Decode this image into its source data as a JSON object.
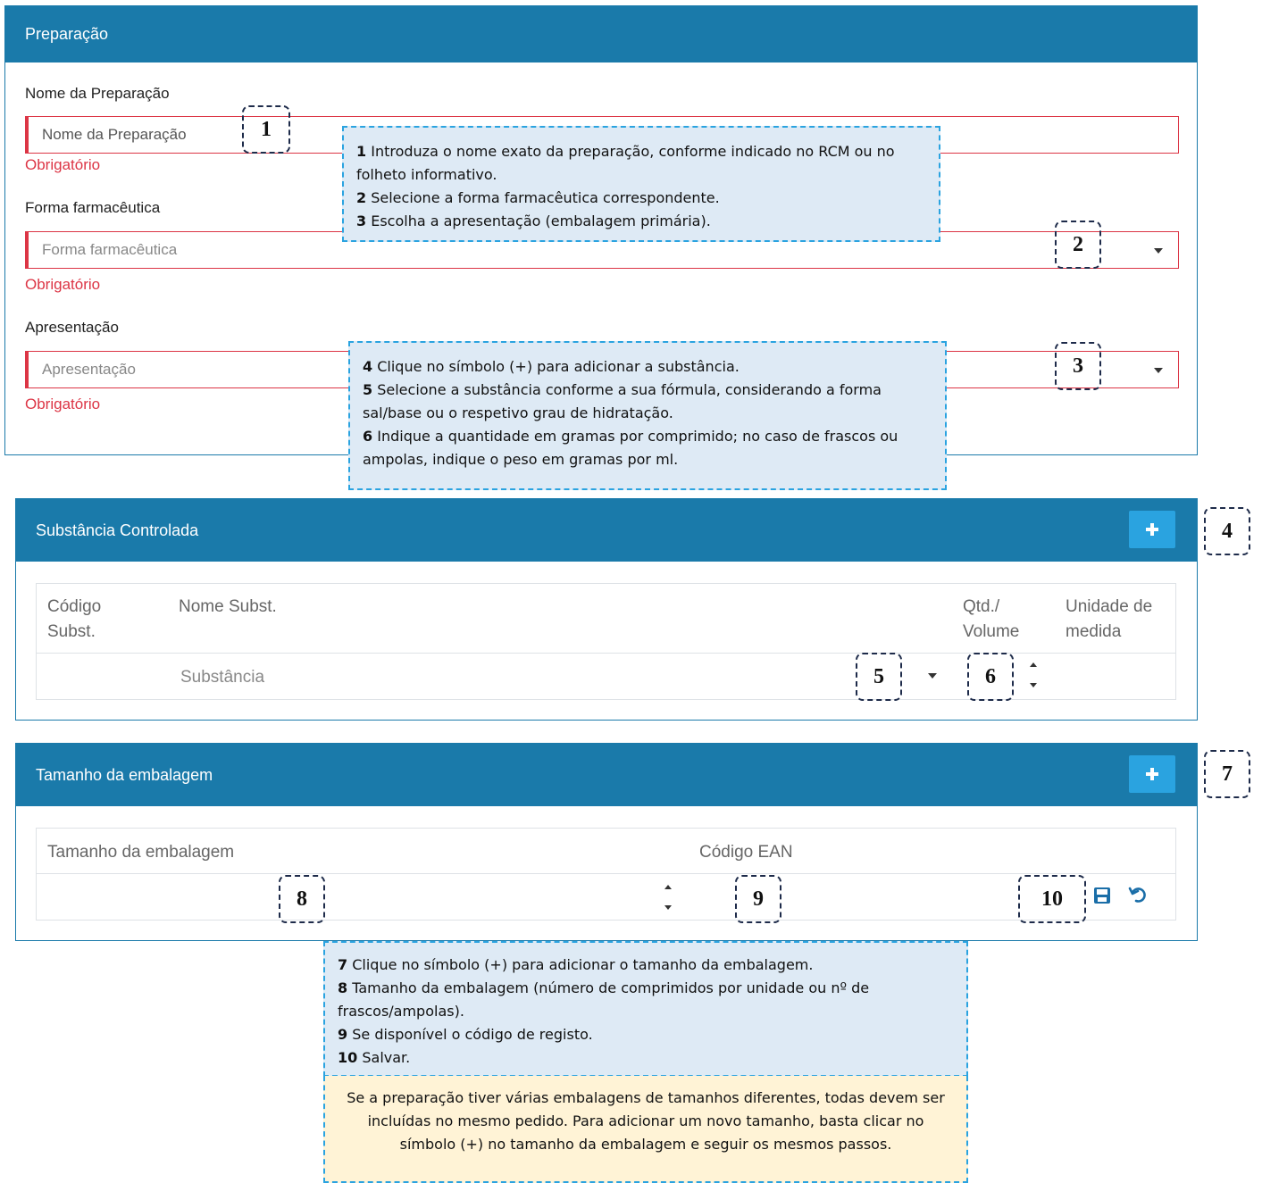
{
  "preparacao": {
    "title": "Preparação",
    "nome_label": "Nome da Preparação",
    "nome_placeholder": "Nome da Preparação",
    "forma_label": "Forma farmacêutica",
    "forma_placeholder": "Forma farmacêutica",
    "apresentacao_label": "Apresentação",
    "apresentacao_placeholder": "Apresentação",
    "required_text": "Obrigatório"
  },
  "substancia": {
    "title": "Substância Controlada",
    "col_codigo": "Código Subst.",
    "col_nome": "Nome Subst.",
    "col_qtd": "Qtd./ Volume",
    "col_unidade": "Unidade de medida",
    "substancia_placeholder": "Substância"
  },
  "embalagem": {
    "title": "Tamanho da embalagem",
    "col_tamanho": "Tamanho da embalagem",
    "col_ean": "Código EAN"
  },
  "markers": [
    "1",
    "2",
    "3",
    "4",
    "5",
    "6",
    "7",
    "8",
    "9",
    "10"
  ],
  "notes": {
    "n1": [
      {
        "num": "1",
        "text": " Introduza o nome exato da preparação, conforme indicado no RCM ou no folheto informativo."
      },
      {
        "num": "2",
        "text": " Selecione a forma farmacêutica correspondente."
      },
      {
        "num": "3",
        "text": " Escolha a apresentação (embalagem primária)."
      }
    ],
    "n2": [
      {
        "num": "4",
        "text": " Clique no símbolo (+) para adicionar a substância."
      },
      {
        "num": "5",
        "text": " Selecione a substância conforme a sua fórmula, considerando a forma sal/base ou o respetivo grau de hidratação."
      },
      {
        "num": "6",
        "text": " Indique a quantidade em gramas por comprimido; no caso de frascos ou ampolas, indique o peso em gramas por ml."
      }
    ],
    "n3": [
      {
        "num": "7",
        "text": " Clique no símbolo (+) para adicionar o tamanho da embalagem."
      },
      {
        "num": "8",
        "text": " Tamanho da embalagem (número de comprimidos por unidade ou nº de frascos/ampolas)."
      },
      {
        "num": "9",
        "text": " Se disponível o código de registo."
      },
      {
        "num": "10",
        "text": " Salvar."
      }
    ],
    "yellow": "Se a preparação tiver várias embalagens de tamanhos diferentes, todas devem ser incluídas no mesmo pedido. Para adicionar um novo tamanho, basta clicar no símbolo (+) no tamanho da embalagem e seguir os mesmos passos."
  },
  "colors": {
    "header": "#1a7aaa",
    "add_button": "#2aa3e0",
    "error": "#dc3545",
    "note_blue": "#deeaf5",
    "note_yellow": "#fff3d6"
  },
  "icons": {
    "add": "plus-icon",
    "save": "save-icon",
    "undo": "undo-icon",
    "dropdown": "caret-down-icon",
    "spinner": "spinner-icon"
  }
}
